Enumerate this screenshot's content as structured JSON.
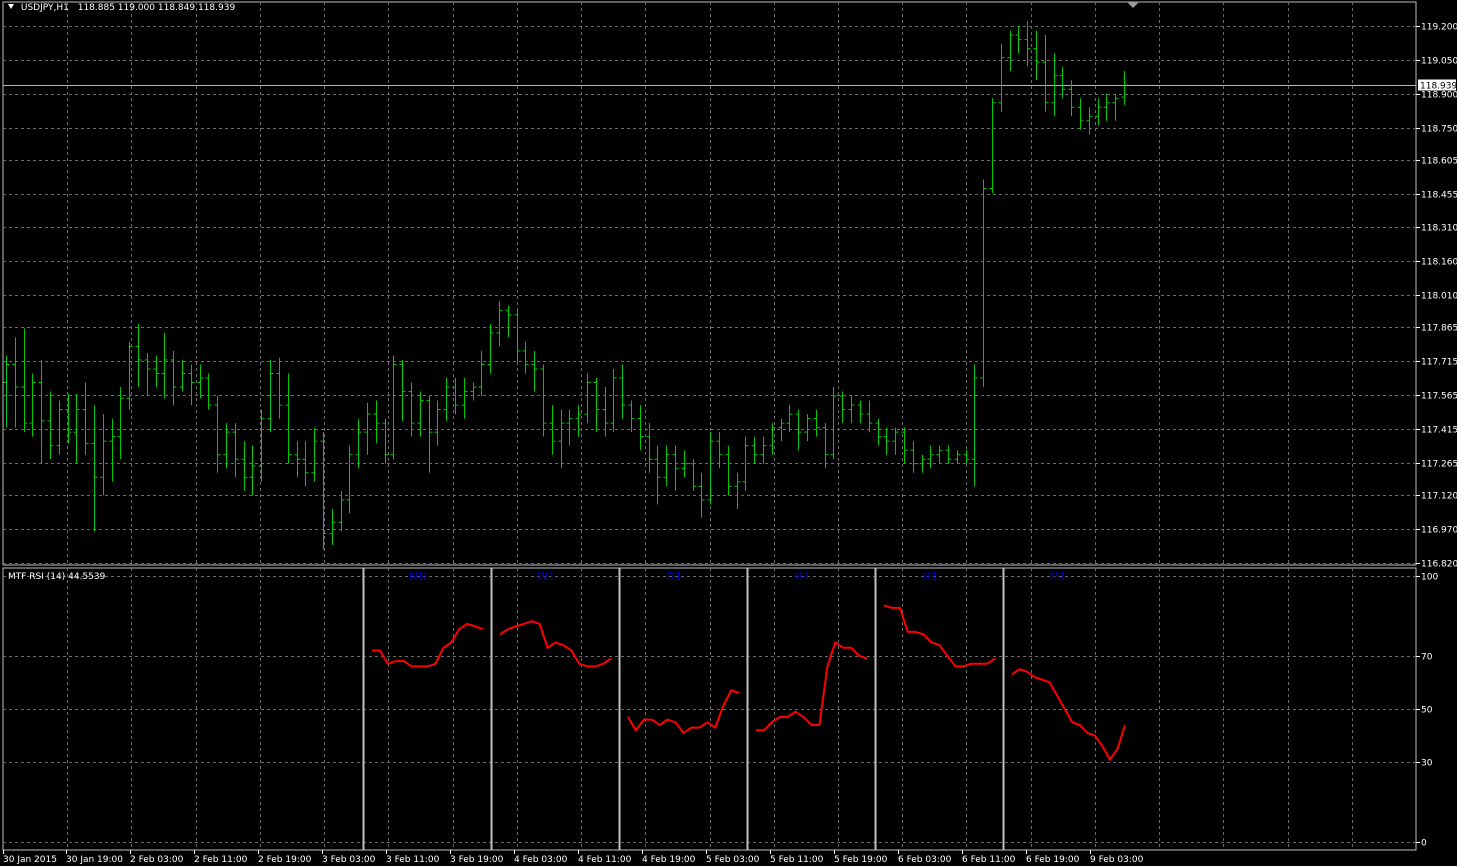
{
  "header": {
    "symbol": "USDJPY,H1",
    "ohlc": "118.885 119.000 118.849 118.939"
  },
  "indicator": {
    "label": "MTF RSI (14) 44.5539"
  },
  "colors": {
    "background": "#000000",
    "grid": "#6b6b6b",
    "bull": "#00c800",
    "rsi": "#ff0000",
    "tf_label": "#0000c8",
    "separator": "#c0c0c0",
    "price_line": "#b4b4b4"
  },
  "chart_data": [
    {
      "type": "bar",
      "subtype": "ohlc",
      "symbol": "USDJPY",
      "timeframe": "H1",
      "current_price": 118.939,
      "ylim": [
        116.82,
        119.28
      ],
      "y_ticks": [
        119.2,
        119.05,
        118.9,
        118.75,
        118.605,
        118.455,
        118.31,
        118.16,
        118.01,
        117.865,
        117.715,
        117.565,
        117.415,
        117.265,
        117.12,
        116.97,
        116.82
      ],
      "y_tick_labels": [
        "119.200",
        "119.050",
        "118.900",
        "118.750",
        "118.605",
        "118.455",
        "118.310",
        "118.160",
        "118.010",
        "117.865",
        "117.715",
        "117.565",
        "117.415",
        "117.265",
        "117.120",
        "116.970",
        "116.820"
      ],
      "x_tick_labels": [
        "30 Jan 2015",
        "30 Jan 19:00",
        "2 Feb 03:00",
        "2 Feb 11:00",
        "2 Feb 19:00",
        "3 Feb 03:00",
        "3 Feb 11:00",
        "3 Feb 19:00",
        "4 Feb 03:00",
        "4 Feb 11:00",
        "4 Feb 19:00",
        "5 Feb 03:00",
        "5 Feb 11:00",
        "5 Feb 19:00",
        "6 Feb 03:00",
        "6 Feb 11:00",
        "6 Feb 19:00",
        "9 Feb 03:00"
      ],
      "bars": [
        [
          117.62,
          117.74,
          117.42,
          117.7
        ],
        [
          117.7,
          117.82,
          117.42,
          117.6
        ],
        [
          117.6,
          117.86,
          117.4,
          117.44
        ],
        [
          117.44,
          117.66,
          117.38,
          117.62
        ],
        [
          117.62,
          117.72,
          117.26,
          117.45
        ],
        [
          117.45,
          117.58,
          117.28,
          117.34
        ],
        [
          117.34,
          117.54,
          117.3,
          117.5
        ],
        [
          117.5,
          117.57,
          117.35,
          117.4
        ],
        [
          117.4,
          117.57,
          117.26,
          117.5
        ],
        [
          117.5,
          117.62,
          117.3,
          117.35
        ],
        [
          117.35,
          117.52,
          116.96,
          117.2
        ],
        [
          117.2,
          117.48,
          117.12,
          117.36
        ],
        [
          117.36,
          117.46,
          117.18,
          117.38
        ],
        [
          117.38,
          117.6,
          117.28,
          117.55
        ],
        [
          117.55,
          117.8,
          117.5,
          117.78
        ],
        [
          117.78,
          117.88,
          117.6,
          117.72
        ],
        [
          117.72,
          117.75,
          117.56,
          117.68
        ],
        [
          117.68,
          117.74,
          117.6,
          117.66
        ],
        [
          117.66,
          117.84,
          117.55,
          117.72
        ],
        [
          117.72,
          117.76,
          117.52,
          117.6
        ],
        [
          117.6,
          117.72,
          117.58,
          117.66
        ],
        [
          117.66,
          117.7,
          117.52,
          117.62
        ],
        [
          117.62,
          117.7,
          117.55,
          117.64
        ],
        [
          117.64,
          117.66,
          117.5,
          117.52
        ],
        [
          117.52,
          117.56,
          117.22,
          117.3
        ],
        [
          117.3,
          117.44,
          117.24,
          117.4
        ],
        [
          117.4,
          117.44,
          117.2,
          117.28
        ],
        [
          117.28,
          117.36,
          117.14,
          117.2
        ],
        [
          117.2,
          117.34,
          117.12,
          117.25
        ],
        [
          117.25,
          117.5,
          117.18,
          117.46
        ],
        [
          117.46,
          117.72,
          117.4,
          117.66
        ],
        [
          117.66,
          117.73,
          117.46,
          117.52
        ],
        [
          117.52,
          117.66,
          117.26,
          117.3
        ],
        [
          117.3,
          117.36,
          117.2,
          117.28
        ],
        [
          117.28,
          117.36,
          117.16,
          117.22
        ],
        [
          117.22,
          117.42,
          117.18,
          117.36
        ],
        [
          117.36,
          117.4,
          116.88,
          116.95
        ],
        [
          116.95,
          117.06,
          116.9,
          117.0
        ],
        [
          117.0,
          117.14,
          116.96,
          117.1
        ],
        [
          117.1,
          117.34,
          117.04,
          117.3
        ],
        [
          117.3,
          117.46,
          117.24,
          117.4
        ],
        [
          117.4,
          117.53,
          117.3,
          117.48
        ],
        [
          117.48,
          117.54,
          117.35,
          117.44
        ],
        [
          117.44,
          117.46,
          117.26,
          117.3
        ],
        [
          117.3,
          117.74,
          117.28,
          117.7
        ],
        [
          117.7,
          117.72,
          117.45,
          117.58
        ],
        [
          117.58,
          117.62,
          117.38,
          117.44
        ],
        [
          117.44,
          117.58,
          117.38,
          117.54
        ],
        [
          117.54,
          117.56,
          117.22,
          117.4
        ],
        [
          117.4,
          117.54,
          117.34,
          117.5
        ],
        [
          117.5,
          117.64,
          117.45,
          117.6
        ],
        [
          117.6,
          117.64,
          117.48,
          117.52
        ],
        [
          117.52,
          117.64,
          117.46,
          117.58
        ],
        [
          117.58,
          117.62,
          117.54,
          117.6
        ],
        [
          117.6,
          117.76,
          117.56,
          117.7
        ],
        [
          117.7,
          117.88,
          117.66,
          117.84
        ],
        [
          117.84,
          117.98,
          117.78,
          117.94
        ],
        [
          117.94,
          117.96,
          117.82,
          117.92
        ],
        [
          117.92,
          117.94,
          117.7,
          117.76
        ],
        [
          117.76,
          117.8,
          117.66,
          117.7
        ],
        [
          117.7,
          117.76,
          117.58,
          117.68
        ],
        [
          117.68,
          117.7,
          117.38,
          117.44
        ],
        [
          117.44,
          117.52,
          117.3,
          117.36
        ],
        [
          117.36,
          117.5,
          117.24,
          117.44
        ],
        [
          117.44,
          117.5,
          117.34,
          117.46
        ],
        [
          117.46,
          117.52,
          117.38,
          117.48
        ],
        [
          117.48,
          117.66,
          117.44,
          117.62
        ],
        [
          117.62,
          117.64,
          117.4,
          117.5
        ],
        [
          117.5,
          117.6,
          117.38,
          117.44
        ],
        [
          117.44,
          117.68,
          117.4,
          117.64
        ],
        [
          117.64,
          117.7,
          117.46,
          117.52
        ],
        [
          117.52,
          117.54,
          117.4,
          117.46
        ],
        [
          117.46,
          117.52,
          117.32,
          117.38
        ],
        [
          117.38,
          117.44,
          117.22,
          117.28
        ],
        [
          117.28,
          117.34,
          117.08,
          117.2
        ],
        [
          117.2,
          117.34,
          117.16,
          117.3
        ],
        [
          117.3,
          117.34,
          117.14,
          117.24
        ],
        [
          117.24,
          117.32,
          117.2,
          117.26
        ],
        [
          117.26,
          117.28,
          117.14,
          117.16
        ],
        [
          117.16,
          117.22,
          117.02,
          117.1
        ],
        [
          117.1,
          117.4,
          117.08,
          117.36
        ],
        [
          117.36,
          117.4,
          117.24,
          117.3
        ],
        [
          117.3,
          117.34,
          117.12,
          117.16
        ],
        [
          117.16,
          117.22,
          117.06,
          117.18
        ],
        [
          117.18,
          117.38,
          117.14,
          117.34
        ],
        [
          117.34,
          117.38,
          117.26,
          117.3
        ],
        [
          117.3,
          117.38,
          117.26,
          117.34
        ],
        [
          117.34,
          117.44,
          117.3,
          117.42
        ],
        [
          117.42,
          117.46,
          117.36,
          117.44
        ],
        [
          117.44,
          117.52,
          117.4,
          117.48
        ],
        [
          117.48,
          117.5,
          117.32,
          117.4
        ],
        [
          117.4,
          117.48,
          117.36,
          117.46
        ],
        [
          117.46,
          117.5,
          117.38,
          117.42
        ],
        [
          117.42,
          117.44,
          117.24,
          117.3
        ],
        [
          117.3,
          117.6,
          117.28,
          117.56
        ],
        [
          117.56,
          117.58,
          117.44,
          117.5
        ],
        [
          117.5,
          117.56,
          117.44,
          117.52
        ],
        [
          117.52,
          117.54,
          117.44,
          117.48
        ],
        [
          117.48,
          117.54,
          117.4,
          117.44
        ],
        [
          117.44,
          117.46,
          117.34,
          117.38
        ],
        [
          117.38,
          117.42,
          117.3,
          117.36
        ],
        [
          117.36,
          117.42,
          117.3,
          117.4
        ],
        [
          117.4,
          117.42,
          117.26,
          117.32
        ],
        [
          117.32,
          117.36,
          117.22,
          117.26
        ],
        [
          117.26,
          117.3,
          117.22,
          117.28
        ],
        [
          117.28,
          117.34,
          117.24,
          117.3
        ],
        [
          117.3,
          117.34,
          117.26,
          117.32
        ],
        [
          117.32,
          117.34,
          117.26,
          117.28
        ],
        [
          117.28,
          117.32,
          117.26,
          117.3
        ],
        [
          117.3,
          117.32,
          117.26,
          117.28
        ],
        [
          117.28,
          117.7,
          117.16,
          117.64
        ],
        [
          117.64,
          118.52,
          117.6,
          118.48
        ],
        [
          118.48,
          118.88,
          118.46,
          118.86
        ],
        [
          118.86,
          119.12,
          118.82,
          119.06
        ],
        [
          119.06,
          119.18,
          119.0,
          119.16
        ],
        [
          119.16,
          119.2,
          119.08,
          119.14
        ],
        [
          119.14,
          119.22,
          119.02,
          119.1
        ],
        [
          119.1,
          119.18,
          118.96,
          119.04
        ],
        [
          119.04,
          119.16,
          118.82,
          118.86
        ],
        [
          118.86,
          119.08,
          118.8,
          118.98
        ],
        [
          118.98,
          119.02,
          118.88,
          118.92
        ],
        [
          118.92,
          118.96,
          118.8,
          118.84
        ],
        [
          118.84,
          118.88,
          118.74,
          118.78
        ],
        [
          118.78,
          118.84,
          118.72,
          118.8
        ],
        [
          118.8,
          118.88,
          118.76,
          118.84
        ],
        [
          118.84,
          118.9,
          118.78,
          118.86
        ],
        [
          118.86,
          118.9,
          118.78,
          118.88
        ],
        [
          118.885,
          119.0,
          118.849,
          118.939
        ]
      ]
    },
    {
      "type": "line",
      "name": "MTF RSI (14)",
      "last_value": 44.5539,
      "ylim": [
        0,
        100
      ],
      "y_ticks": [
        100,
        70,
        50,
        30,
        0
      ],
      "timeframe_labels": [
        "MN",
        "W1",
        "D1",
        "H4",
        "H1",
        "M1"
      ],
      "series": [
        {
          "name": "MN",
          "values": [
            72,
            72,
            67,
            68,
            68,
            66,
            66,
            66,
            67,
            73,
            75,
            80,
            82,
            81,
            80
          ]
        },
        {
          "name": "W1",
          "values": [
            78,
            80,
            81,
            82,
            83,
            82,
            73,
            75,
            74,
            72,
            67,
            66,
            66,
            67,
            69
          ]
        },
        {
          "name": "D1",
          "values": [
            47,
            42,
            46,
            46,
            44,
            46,
            45,
            41,
            43,
            43,
            45,
            43,
            51,
            57,
            56
          ]
        },
        {
          "name": "H4",
          "values": [
            42,
            42,
            45,
            47,
            47,
            49,
            47,
            44,
            44,
            66,
            75,
            73,
            73,
            70,
            69
          ]
        },
        {
          "name": "H1",
          "values": [
            89,
            88,
            88,
            79,
            79,
            78,
            75,
            74,
            70,
            66,
            66,
            67,
            67,
            67,
            69
          ]
        },
        {
          "name": "M1",
          "values": [
            63,
            65,
            64,
            62,
            61,
            60,
            55,
            50,
            45,
            44,
            41,
            40,
            36,
            31,
            35,
            44
          ]
        }
      ]
    }
  ]
}
